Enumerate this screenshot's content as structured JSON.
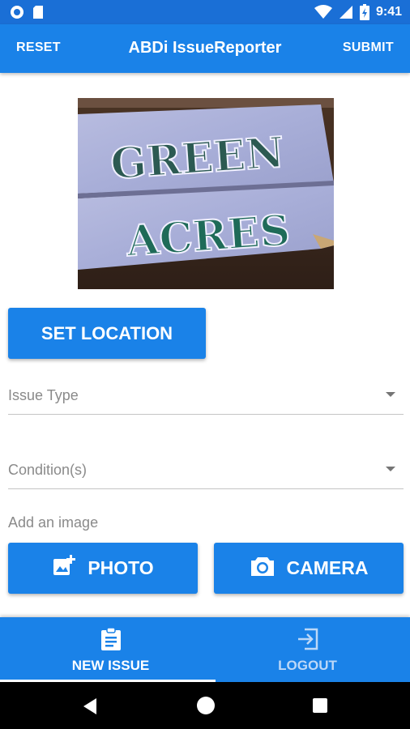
{
  "status_bar": {
    "time": "9:41",
    "icons": [
      "status-circle-icon",
      "sd-card-icon",
      "wifi-icon",
      "signal-icon",
      "battery-icon"
    ]
  },
  "app_bar": {
    "reset_label": "RESET",
    "title": "ABDi IssueReporter",
    "submit_label": "SUBMIT"
  },
  "photo": {
    "line1": "GREEN",
    "line2": "ACRES"
  },
  "form": {
    "set_location_label": "SET LOCATION",
    "issue_type_placeholder": "Issue Type",
    "conditions_placeholder": "Condition(s)",
    "add_image_label": "Add an image",
    "photo_button_label": "PHOTO",
    "camera_button_label": "CAMERA"
  },
  "bottom_nav": {
    "items": [
      {
        "label": "NEW ISSUE",
        "icon": "clipboard-icon",
        "active": true
      },
      {
        "label": "LOGOUT",
        "icon": "logout-icon",
        "active": false
      }
    ]
  },
  "colors": {
    "primary": "#1a82e8",
    "status_bar": "#1a6fd6",
    "inactive_nav": "#bcd8f8"
  }
}
